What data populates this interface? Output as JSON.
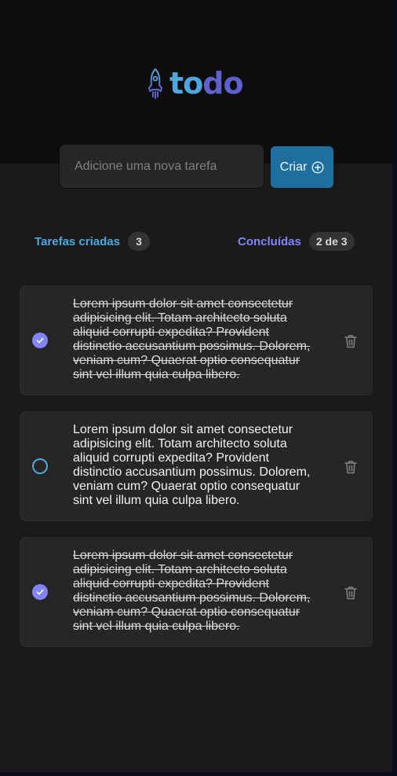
{
  "app": {
    "logo_part_1": "to",
    "logo_part_2": "do",
    "icons": {
      "logo": "rocket-icon",
      "create": "plus-circle-icon",
      "done": "check-icon",
      "delete": "trash-icon"
    },
    "colors": {
      "blue": "#4ea8de",
      "blue_dark": "#1e6f9f",
      "purple": "#8284fa",
      "purple_dark": "#5e60ce"
    }
  },
  "new_task": {
    "placeholder": "Adicione uma nova tarefa",
    "value": "",
    "create_label": "Criar"
  },
  "summary": {
    "created_label": "Tarefas criadas",
    "created_count": "3",
    "done_label": "Concluídas",
    "done_count": "2 de 3"
  },
  "tasks": [
    {
      "text": "Lorem ipsum dolor sit amet consectetur adipisicing elit. Totam architecto soluta aliquid corrupti expedita? Provident distinctio accusantium possimus. Dolorem, veniam cum? Quaerat optio consequatur sint vel illum quia culpa libero.",
      "done": true
    },
    {
      "text": "Lorem ipsum dolor sit amet consectetur adipisicing elit. Totam architecto soluta aliquid corrupti expedita? Provident distinctio accusantium possimus. Dolorem, veniam cum? Quaerat optio consequatur sint vel illum quia culpa libero.",
      "done": false
    },
    {
      "text": "Lorem ipsum dolor sit amet consectetur adipisicing elit. Totam architecto soluta aliquid corrupti expedita? Provident distinctio accusantium possimus. Dolorem, veniam cum? Quaerat optio consequatur sint vel illum quia culpa libero.",
      "done": true
    }
  ]
}
